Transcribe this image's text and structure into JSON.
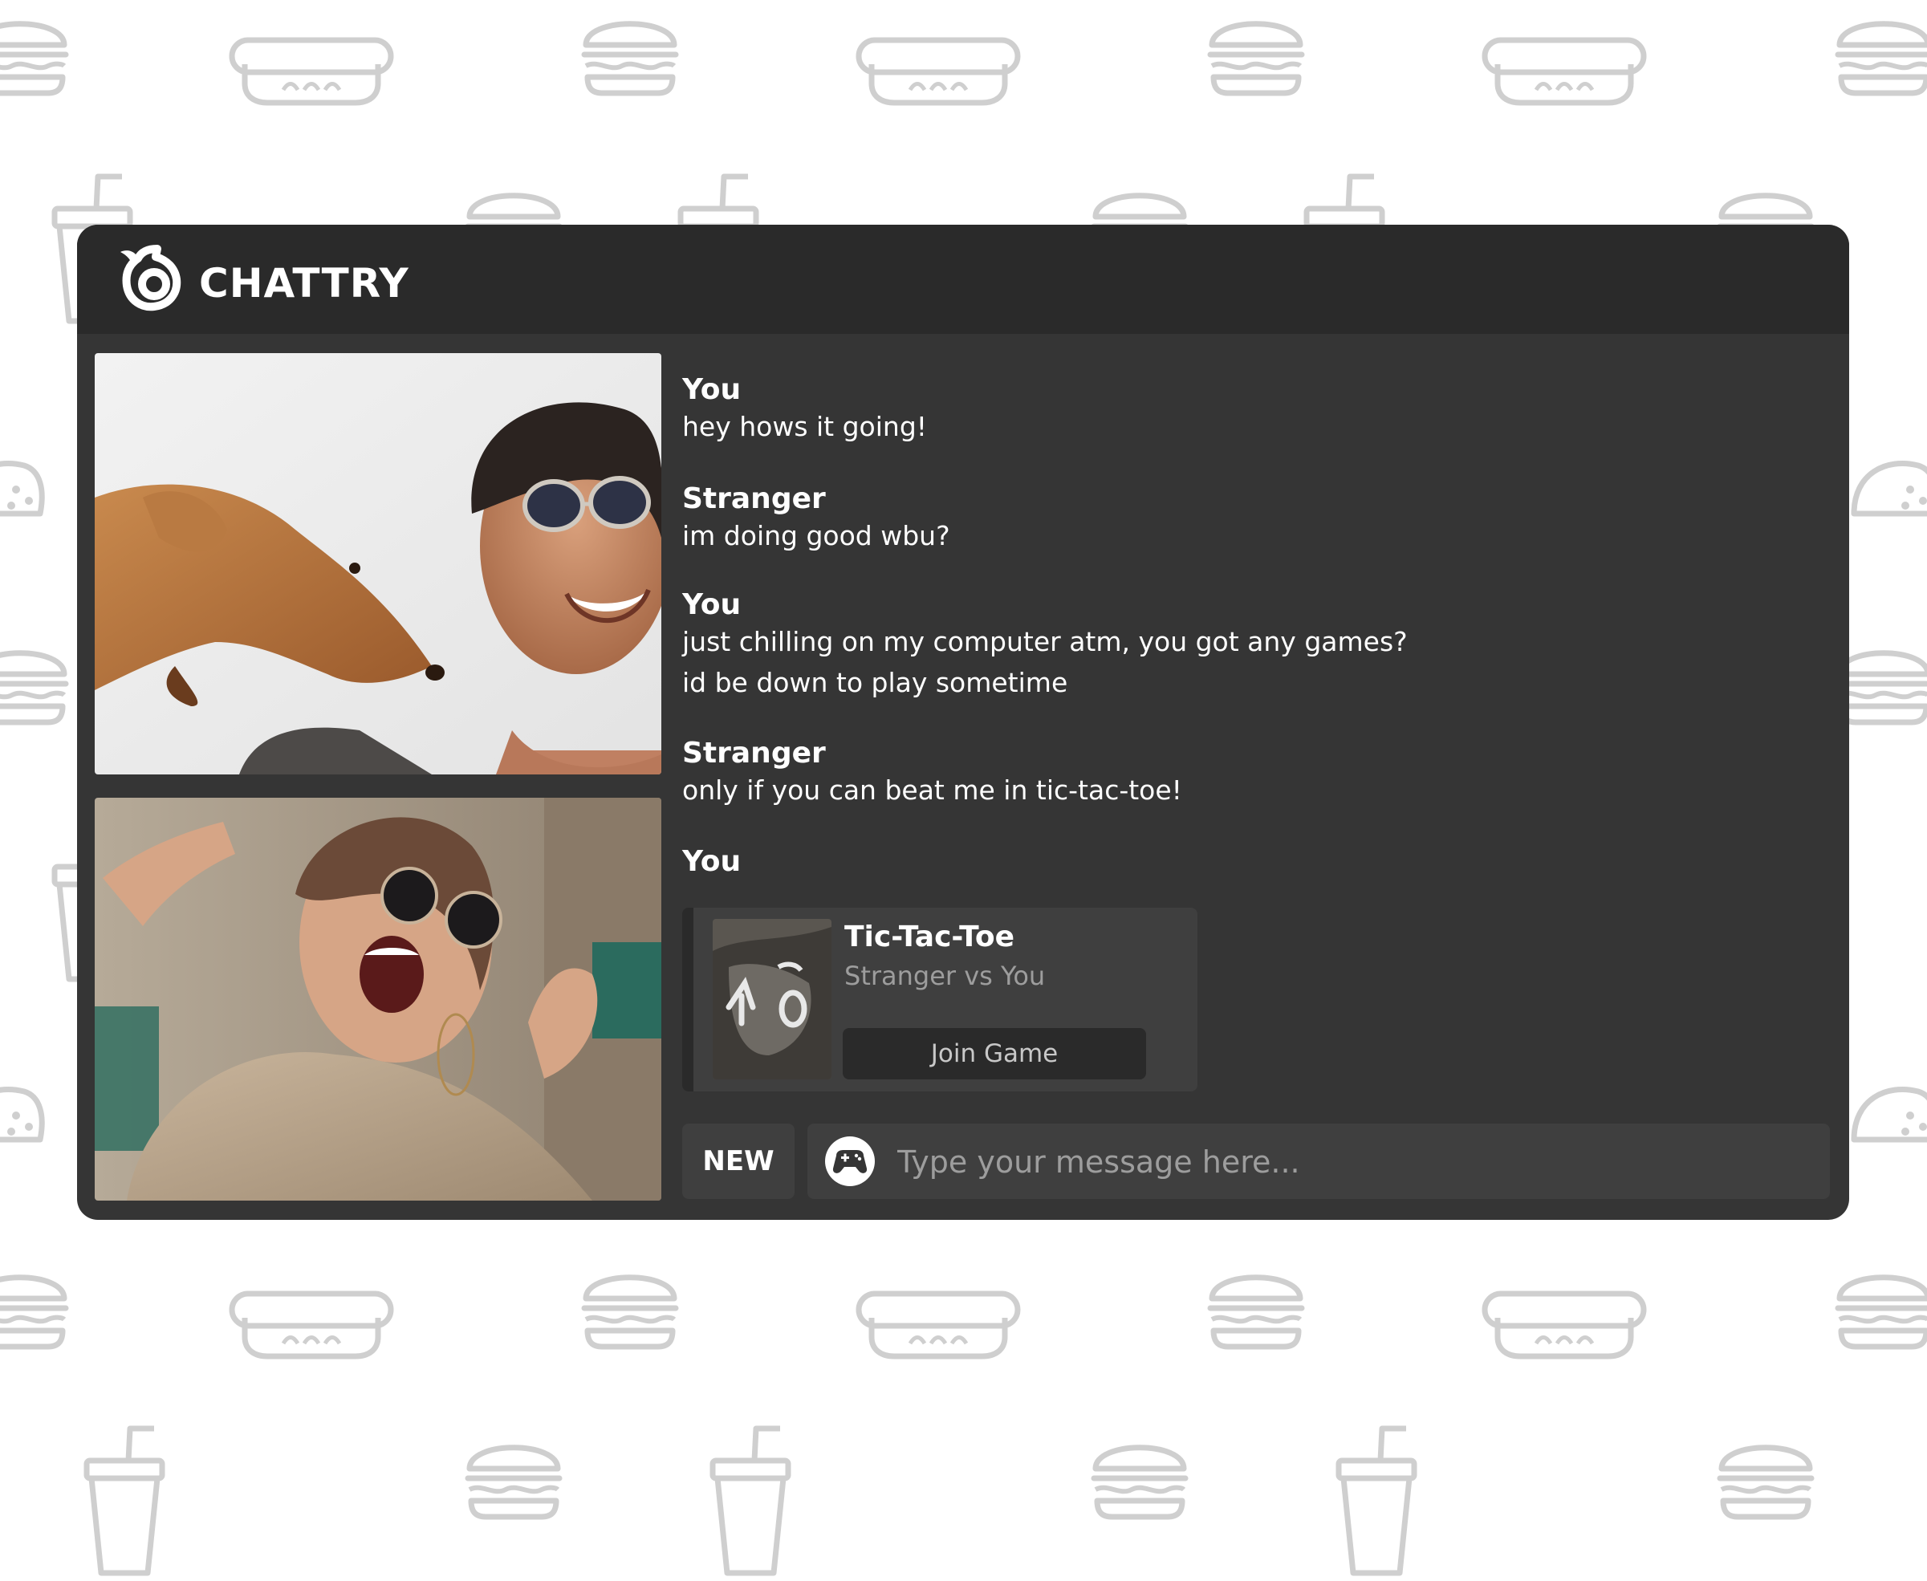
{
  "app": {
    "title": "CHATTRY",
    "logo_icon": "flame-logo-icon"
  },
  "colors": {
    "page_background": "#ffffff",
    "pattern_stroke": "#cfcfcf",
    "window_background": "#353535",
    "header_background": "#2a2a2a",
    "card_background": "#3f3f3f",
    "text_primary": "#ffffff",
    "text_muted": "#9d9d9d"
  },
  "background_pattern_icons": [
    "burger-icon",
    "hotdog-icon",
    "soda-cup-icon",
    "taco-icon"
  ],
  "video": {
    "self_tile": "photo-man-with-dog",
    "stranger_tile": "photo-woman-sunglasses"
  },
  "chat": {
    "messages": [
      {
        "sender": "You",
        "lines": [
          "hey hows it going!"
        ]
      },
      {
        "sender": "Stranger",
        "lines": [
          "im doing good wbu?"
        ]
      },
      {
        "sender": "You",
        "lines": [
          "just chilling on my computer atm, you got any games?",
          "id be down to play sometime"
        ]
      },
      {
        "sender": "Stranger",
        "lines": [
          "only if you can beat me in tic-tac-toe!"
        ]
      },
      {
        "sender": "You",
        "lines": []
      }
    ],
    "game_invite": {
      "title": "Tic-Tac-Toe",
      "subtitle": "Stranger vs You",
      "button_label": "Join Game",
      "thumbnail": "tic-tac-toe-thumbnail"
    }
  },
  "composer": {
    "new_label": "NEW",
    "placeholder": "Type your message here...",
    "value": "",
    "game_icon": "gamepad-icon"
  }
}
